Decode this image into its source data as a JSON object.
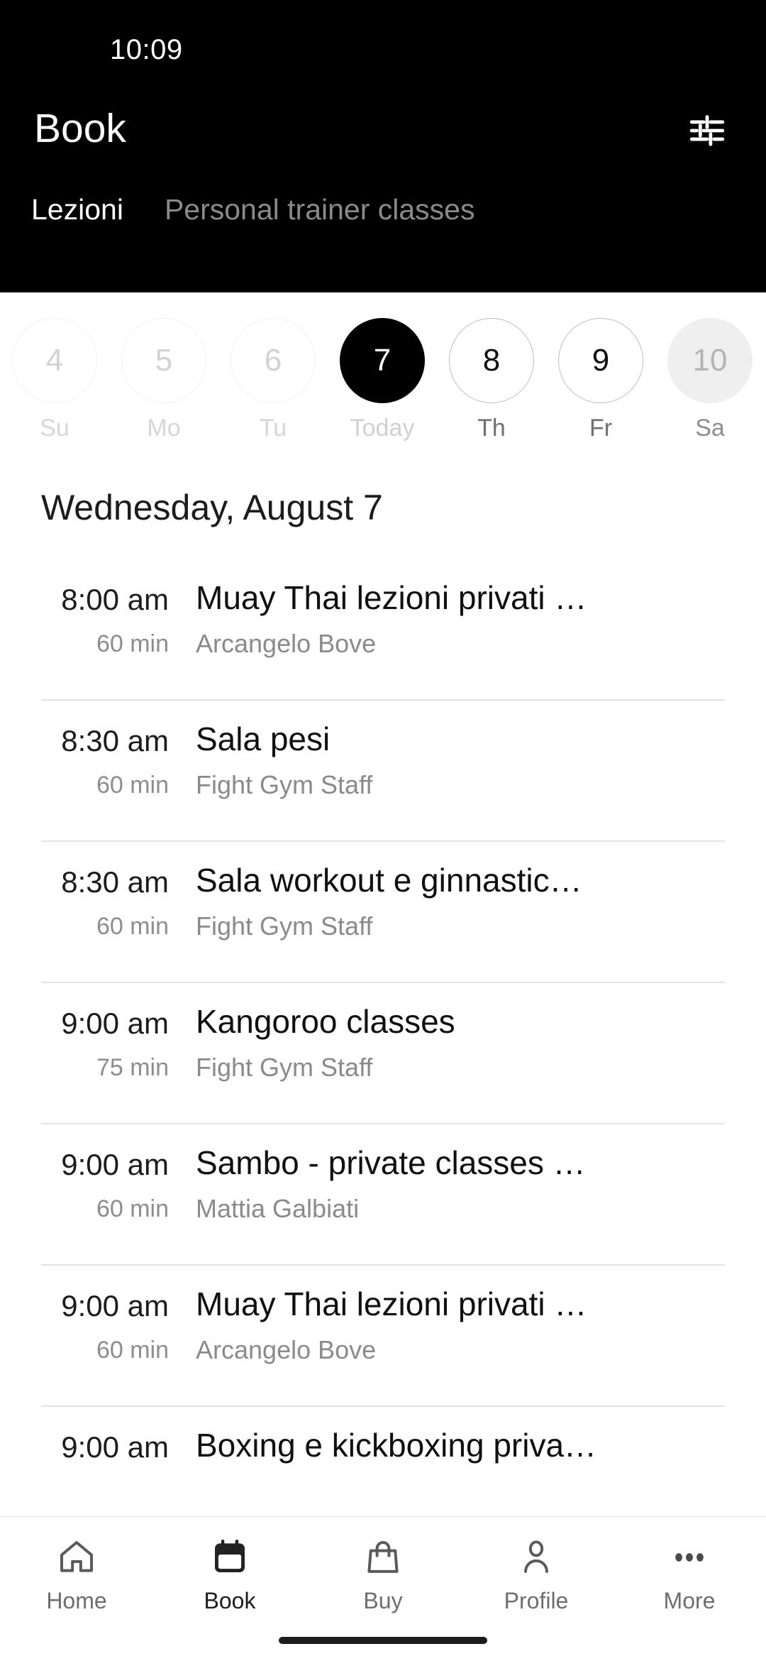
{
  "status_bar": {
    "time": "10:09"
  },
  "header": {
    "title": "Book",
    "filter_icon": "tune-sliders-icon",
    "tabs": [
      {
        "label": "Lezioni",
        "active": true
      },
      {
        "label": "Personal trainer classes",
        "active": false
      }
    ]
  },
  "date_strip": {
    "days": [
      {
        "num": "4",
        "label": "Su",
        "state": "past"
      },
      {
        "num": "5",
        "label": "Mo",
        "state": "past"
      },
      {
        "num": "6",
        "label": "Tu",
        "state": "past"
      },
      {
        "num": "7",
        "label": "Today",
        "state": "today"
      },
      {
        "num": "8",
        "label": "Th",
        "state": "future"
      },
      {
        "num": "9",
        "label": "Fr",
        "state": "future"
      },
      {
        "num": "10",
        "label": "Sa",
        "state": "muted"
      }
    ]
  },
  "day_heading": "Wednesday, August 7",
  "classes": [
    {
      "time": "8:00 am",
      "duration": "60 min",
      "title": "Muay Thai lezioni privati …",
      "instructor": "Arcangelo Bove"
    },
    {
      "time": "8:30 am",
      "duration": "60 min",
      "title": "Sala pesi",
      "instructor": "Fight Gym Staff"
    },
    {
      "time": "8:30 am",
      "duration": "60 min",
      "title": "Sala workout e ginnastic…",
      "instructor": "Fight Gym Staff"
    },
    {
      "time": "9:00 am",
      "duration": "75 min",
      "title": "Kangoroo classes",
      "instructor": "Fight Gym Staff"
    },
    {
      "time": "9:00 am",
      "duration": "60 min",
      "title": "Sambo - private classes …",
      "instructor": "Mattia Galbiati"
    },
    {
      "time": "9:00 am",
      "duration": "60 min",
      "title": "Muay Thai lezioni privati …",
      "instructor": "Arcangelo Bove"
    },
    {
      "time": "9:00 am",
      "duration": "",
      "title": "Boxing e kickboxing priva…",
      "instructor": ""
    }
  ],
  "bottom_nav": {
    "items": [
      {
        "label": "Home",
        "icon": "home-icon",
        "active": false
      },
      {
        "label": "Book",
        "icon": "calendar-icon",
        "active": true
      },
      {
        "label": "Buy",
        "icon": "bag-icon",
        "active": false
      },
      {
        "label": "Profile",
        "icon": "person-icon",
        "active": false
      },
      {
        "label": "More",
        "icon": "ellipsis-icon",
        "active": false
      }
    ]
  },
  "colors": {
    "header_bg": "#000000",
    "page_bg": "#ffffff",
    "accent": "#000000",
    "muted_text": "#8a8a8a",
    "divider": "#e3e3e3"
  }
}
